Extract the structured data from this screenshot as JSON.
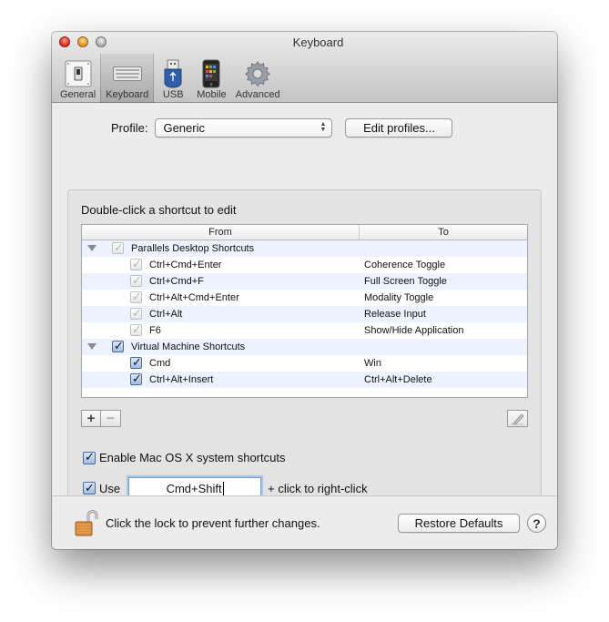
{
  "window": {
    "title": "Keyboard"
  },
  "toolbar": {
    "items": [
      {
        "label": "General",
        "icon": "general-switch-icon",
        "active": false
      },
      {
        "label": "Keyboard",
        "icon": "keyboard-icon",
        "active": true
      },
      {
        "label": "USB",
        "icon": "usb-icon",
        "active": false
      },
      {
        "label": "Mobile",
        "icon": "mobile-phone-icon",
        "active": false
      },
      {
        "label": "Advanced",
        "icon": "gear-icon",
        "active": false
      }
    ]
  },
  "profile": {
    "label": "Profile:",
    "selected": "Generic",
    "edit_button": "Edit profiles..."
  },
  "shortcuts": {
    "hint": "Double-click a shortcut to edit",
    "columns": {
      "from": "From",
      "to": "To"
    },
    "rows": [
      {
        "type": "group",
        "from": "Parallels Desktop Shortcuts",
        "to": "",
        "checked": true,
        "disabled": true,
        "expanded": true
      },
      {
        "type": "item",
        "from": "Ctrl+Cmd+Enter",
        "to": "Coherence Toggle",
        "checked": true,
        "disabled": true
      },
      {
        "type": "item",
        "from": "Ctrl+Cmd+F",
        "to": "Full Screen Toggle",
        "checked": true,
        "disabled": true
      },
      {
        "type": "item",
        "from": "Ctrl+Alt+Cmd+Enter",
        "to": "Modality Toggle",
        "checked": true,
        "disabled": true
      },
      {
        "type": "item",
        "from": "Ctrl+Alt",
        "to": "Release Input",
        "checked": true,
        "disabled": true
      },
      {
        "type": "item",
        "from": "F6",
        "to": "Show/Hide Application",
        "checked": true,
        "disabled": true
      },
      {
        "type": "group",
        "from": "Virtual Machine Shortcuts",
        "to": "",
        "checked": true,
        "disabled": false,
        "expanded": true
      },
      {
        "type": "item",
        "from": "Cmd",
        "to": "Win",
        "checked": true,
        "disabled": false
      },
      {
        "type": "item",
        "from": "Ctrl+Alt+Insert",
        "to": "Ctrl+Alt+Delete",
        "checked": true,
        "disabled": false
      }
    ],
    "add_label": "+",
    "remove_label": "−"
  },
  "options": {
    "enable_system_shortcuts": {
      "label": "Enable Mac OS X system shortcuts",
      "checked": true
    },
    "right_click": {
      "prefix": "Use",
      "value": "Cmd+Shift",
      "suffix": "+ click to right-click",
      "checked": true
    }
  },
  "footer": {
    "lock_text": "Click the lock to prevent further changes.",
    "restore_button": "Restore Defaults",
    "help_label": "?"
  },
  "check_glyph": "✓"
}
